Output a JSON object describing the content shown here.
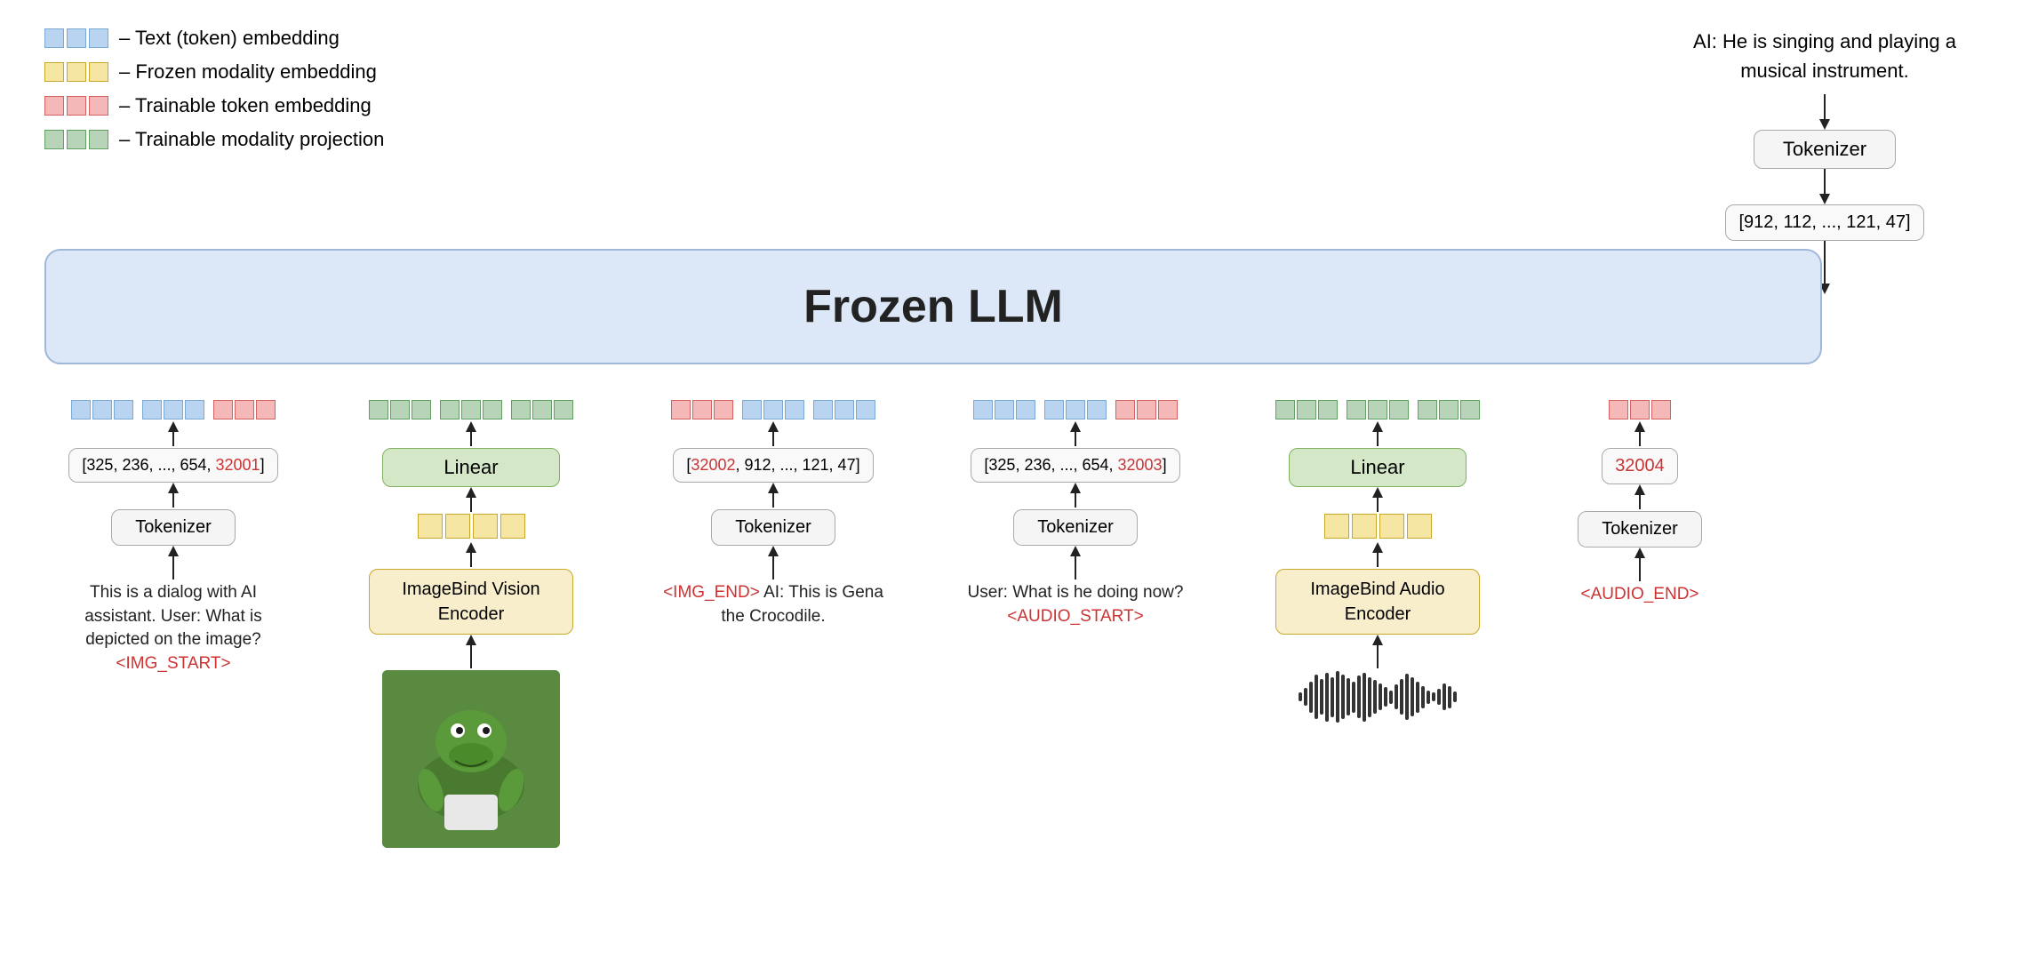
{
  "legend": {
    "items": [
      {
        "color": "blue",
        "label": "– Text (token) embedding"
      },
      {
        "color": "yellow",
        "label": "– Frozen modality embedding"
      },
      {
        "color": "red",
        "label": "– Trainable token embedding"
      },
      {
        "color": "green",
        "label": "– Trainable modality projection"
      }
    ]
  },
  "frozen_llm_label": "Frozen LLM",
  "top_right": {
    "ai_text": "AI: He is singing and playing a musical instrument.",
    "tokenizer_label": "Tokenizer",
    "seq_label": "[912, 112, ..., 121, 47]"
  },
  "columns": [
    {
      "id": "text-col",
      "token_groups": [
        {
          "color": "blue",
          "count": 3
        },
        {
          "color": "blue",
          "count": 3
        },
        {
          "color": "red",
          "count": 3
        }
      ],
      "seq_label": "[325, 236, ..., 654, <32001>]",
      "seq_red": "32001",
      "tokenizer_label": "Tokenizer",
      "input_text": "This is a dialog with AI assistant. User: What is depicted on the image? <IMG_START>",
      "input_red": "<IMG_START>"
    },
    {
      "id": "vision-col",
      "token_groups": [
        {
          "color": "green",
          "count": 3
        },
        {
          "color": "green",
          "count": 3
        },
        {
          "color": "green",
          "count": 3
        }
      ],
      "linear_label": "Linear",
      "frozen_embed": {
        "color": "yellow",
        "count": 4
      },
      "encoder_label": "ImageBind Vision Encoder",
      "has_image": true
    },
    {
      "id": "img-response-col",
      "token_groups": [
        {
          "color": "red",
          "count": 3
        },
        {
          "color": "blue",
          "count": 3
        },
        {
          "color": "blue",
          "count": 3
        }
      ],
      "seq_label": "[<32002>, 912, ..., 121, 47]",
      "seq_red": "32002",
      "tokenizer_label": "Tokenizer",
      "input_text": "<IMG_END> AI: This is Gena the Crocodile.",
      "input_red": "<IMG_END>"
    },
    {
      "id": "audio-question-col",
      "token_groups": [
        {
          "color": "blue",
          "count": 3
        },
        {
          "color": "blue",
          "count": 3
        },
        {
          "color": "red",
          "count": 3
        }
      ],
      "seq_label": "[325, 236, ..., 654, <32003>]",
      "seq_red": "32003",
      "tokenizer_label": "Tokenizer",
      "input_text": "User: What is he doing now? <AUDIO_START>",
      "input_red": "<AUDIO_START>"
    },
    {
      "id": "audio-col",
      "token_groups": [
        {
          "color": "green",
          "count": 3
        },
        {
          "color": "green",
          "count": 3
        },
        {
          "color": "green",
          "count": 3
        }
      ],
      "linear_label": "Linear",
      "frozen_embed": {
        "color": "yellow",
        "count": 4
      },
      "encoder_label": "ImageBind Audio Encoder",
      "has_waveform": true
    },
    {
      "id": "audio-end-col",
      "token_groups": [
        {
          "color": "red",
          "count": 3
        }
      ],
      "seq_label": "32004",
      "seq_red": "32004",
      "tokenizer_label": "Tokenizer",
      "input_text": "<AUDIO_END>",
      "input_red": "<AUDIO_END>"
    }
  ]
}
